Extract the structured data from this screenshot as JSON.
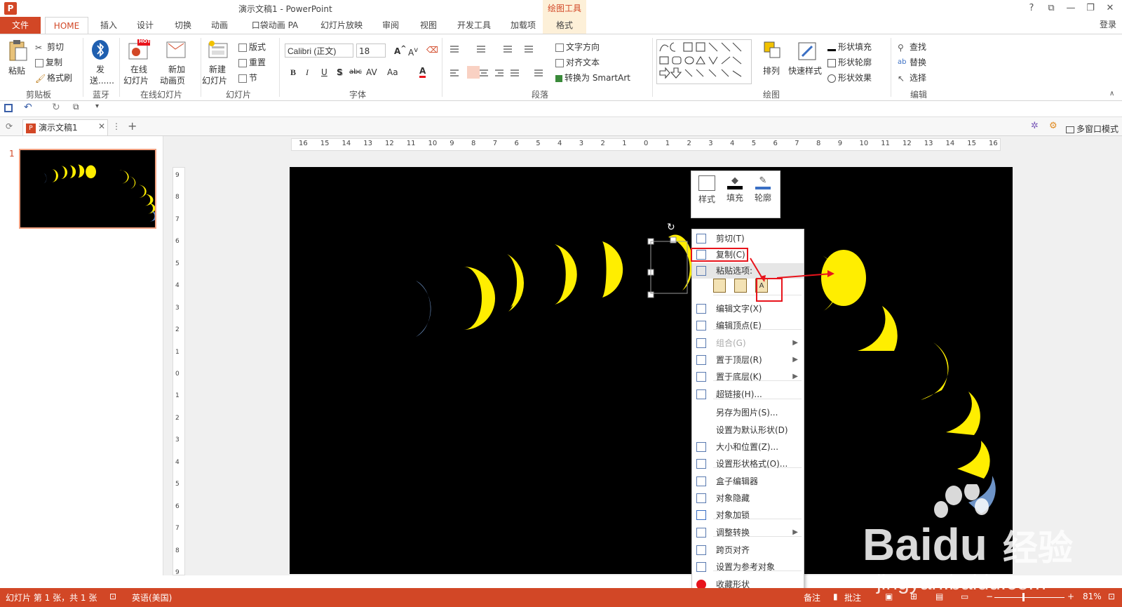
{
  "window": {
    "title": "演示文稿1 - PowerPoint",
    "app_icon_letter": "P",
    "controls": [
      "?",
      "⧉",
      "—",
      "❐",
      "✕"
    ],
    "login": "登录",
    "context_tab_group": "绘图工具"
  },
  "tabs": [
    "文件",
    "HOME",
    "插入",
    "设计",
    "切换",
    "动画",
    "口袋动画 PA",
    "幻灯片放映",
    "审阅",
    "视图",
    "开发工具",
    "加载项",
    "格式"
  ],
  "ribbon": {
    "clipboard": {
      "paste": "粘贴",
      "cut": "剪切",
      "copy": "复制",
      "format_painter": "格式刷",
      "label": "剪贴板"
    },
    "bluetooth": {
      "send_line1": "发",
      "send_line2": "送......",
      "label": "蓝牙"
    },
    "online_slides": {
      "online": "在线",
      "online2": "幻灯片",
      "new": "新加",
      "new2": "动画页",
      "hot": "HOT",
      "label": "在线幻灯片"
    },
    "slides": {
      "new_slide": "新建",
      "new_slide2": "幻灯片",
      "layout": "版式",
      "reset": "重置",
      "section": "节",
      "label": "幻灯片"
    },
    "font": {
      "name": "Calibri (正文)",
      "size": "18",
      "buttons": [
        "B",
        "I",
        "U",
        "S",
        "abc",
        "AV",
        "Aa",
        "A"
      ],
      "label": "字体"
    },
    "paragraph": {
      "text_direction": "文字方向",
      "align_text": "对齐文本",
      "smartart": "转换为 SmartArt",
      "label": "段落"
    },
    "drawing": {
      "arrange": "排列",
      "quick_styles": "快速样式",
      "shape_fill": "形状填充",
      "shape_outline": "形状轮廓",
      "shape_effects": "形状效果",
      "label": "绘图"
    },
    "editing": {
      "find": "查找",
      "replace": "替换",
      "select": "选择",
      "label": "编辑"
    }
  },
  "doc_tab": {
    "name": "演示文稿1",
    "right_label": "多窗口模式"
  },
  "thumbnail": {
    "number": "1"
  },
  "ruler": {
    "h_ticks": [
      "16",
      "15",
      "14",
      "13",
      "12",
      "11",
      "10",
      "9",
      "8",
      "7",
      "6",
      "5",
      "4",
      "3",
      "2",
      "1",
      "0",
      "1",
      "2",
      "3",
      "4",
      "5",
      "6",
      "7",
      "8",
      "9",
      "10",
      "11",
      "12",
      "13",
      "14",
      "15",
      "16"
    ],
    "v_ticks": [
      "9",
      "8",
      "7",
      "6",
      "5",
      "4",
      "3",
      "2",
      "1",
      "0",
      "1",
      "2",
      "3",
      "4",
      "5",
      "6",
      "7",
      "8",
      "9"
    ]
  },
  "mini_toolbar": [
    "样式",
    "填充",
    "轮廓"
  ],
  "context_menu": {
    "items": [
      {
        "label": "剪切(T)",
        "icon": "scissors-icon",
        "enabled": true
      },
      {
        "label": "复制(C)",
        "icon": "copy-icon",
        "enabled": true
      },
      {
        "label": "粘贴选项:",
        "icon": "paste-icon",
        "enabled": true,
        "header": true
      },
      {
        "label": "编辑文字(X)",
        "icon": "edit-text-icon",
        "enabled": true
      },
      {
        "label": "编辑顶点(E)",
        "icon": "edit-points-icon",
        "enabled": true
      },
      {
        "label": "组合(G)",
        "icon": "group-icon",
        "enabled": false,
        "submenu": true
      },
      {
        "label": "置于顶层(R)",
        "icon": "bring-front-icon",
        "enabled": true,
        "submenu": true
      },
      {
        "label": "置于底层(K)",
        "icon": "send-back-icon",
        "enabled": true,
        "submenu": true
      },
      {
        "label": "超链接(H)...",
        "icon": "hyperlink-icon",
        "enabled": true
      },
      {
        "label": "另存为图片(S)...",
        "icon": "",
        "enabled": true
      },
      {
        "label": "设置为默认形状(D)",
        "icon": "",
        "enabled": true
      },
      {
        "label": "大小和位置(Z)...",
        "icon": "size-icon",
        "enabled": true
      },
      {
        "label": "设置形状格式(O)...",
        "icon": "format-shape-icon",
        "enabled": true
      },
      {
        "label": "盒子编辑器",
        "icon": "box-editor-icon",
        "enabled": true
      },
      {
        "label": "对象隐藏",
        "icon": "eye-icon",
        "enabled": true
      },
      {
        "label": "对象加锁",
        "icon": "lock-icon",
        "enabled": true
      },
      {
        "label": "调整转换",
        "icon": "convert-icon",
        "enabled": true,
        "submenu": true
      },
      {
        "label": "跨页对齐",
        "icon": "align-pages-icon",
        "enabled": true
      },
      {
        "label": "设置为参考对象",
        "icon": "reference-icon",
        "enabled": true
      },
      {
        "label": "收藏形状",
        "icon": "heart-icon",
        "enabled": true
      }
    ]
  },
  "status": {
    "slide_info": "幻灯片 第 1 张，共 1 张",
    "language": "英语(美国)",
    "notes": "备注",
    "comments": "批注",
    "zoom": "81%"
  },
  "watermark": {
    "brand": "Baidu",
    "cn": "经验",
    "url": "jingyan.baidu.com"
  },
  "colors": {
    "accent": "#d24726",
    "moon": "#ffee00",
    "highlight": "#e8141c"
  }
}
